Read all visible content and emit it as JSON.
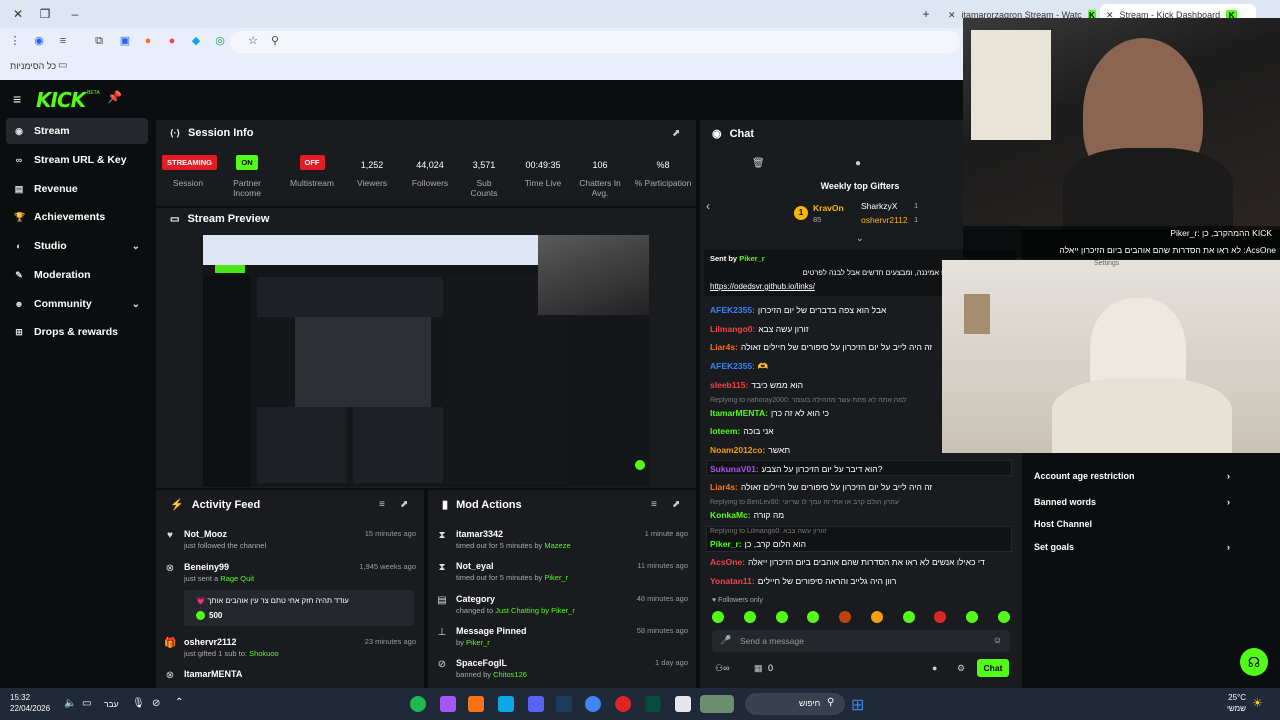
{
  "browser": {
    "tabs": [
      {
        "title": "itamarorzagron Stream - Watc"
      },
      {
        "title": "Stream - Kick Dashboard"
      }
    ],
    "bookmarks_label": "כל הסימניות"
  },
  "header": {
    "logo": "KICK",
    "logo_badge": "BETA"
  },
  "sidebar": {
    "items": [
      {
        "label": "Stream"
      },
      {
        "label": "Stream URL & Key"
      },
      {
        "label": "Revenue"
      },
      {
        "label": "Achievements"
      },
      {
        "label": "Studio"
      },
      {
        "label": "Moderation"
      },
      {
        "label": "Community"
      },
      {
        "label": "Drops & rewards"
      }
    ]
  },
  "session": {
    "title": "Session Info",
    "stats": [
      {
        "value": "STREAMING",
        "label": "Session"
      },
      {
        "value": "ON",
        "label": "Partner Income"
      },
      {
        "value": "OFF",
        "label": "Multistream"
      },
      {
        "value": "1,252",
        "label": "Viewers"
      },
      {
        "value": "44,024",
        "label": "Followers"
      },
      {
        "value": "3,571",
        "label": "Sub Counts"
      },
      {
        "value": "00:49:35",
        "label": "Time Live"
      },
      {
        "value": "106",
        "label": "Chatters In Avg."
      },
      {
        "value": "%8",
        "label": "% Participation"
      }
    ]
  },
  "preview": {
    "title": "Stream Preview"
  },
  "activity": {
    "title": "Activity Feed",
    "rows": [
      {
        "name": "Not_Mooz",
        "sub": "just followed the channel",
        "time": "15 minutes ago"
      },
      {
        "name": "Beneiny99",
        "sub": "just sent a",
        "sub_hl": "Rage Quit",
        "time": "1,945 weeks ago",
        "message": "עודד תהיה חזק אחי טתם צר עין אוהבים אותך 💗",
        "amount": "500"
      },
      {
        "name": "oshervr2112",
        "sub": "just gifted 1 sub to:",
        "sub_hl": "Shokuoo",
        "time": "23 minutes ago"
      },
      {
        "name": "ItamarMENTA",
        "sub": "",
        "time": ""
      }
    ]
  },
  "mod": {
    "title": "Mod Actions",
    "rows": [
      {
        "name": "itamar3342",
        "sub": "timed out for 5 minutes by",
        "by": "Mazeze",
        "time": "1 minute ago"
      },
      {
        "name": "Not_eyal",
        "sub": "timed out for 5 minutes by",
        "by": "Piker_r",
        "time": "11 minutes ago"
      },
      {
        "name": "Category",
        "sub": "changed to",
        "by": "Just Chatting by Piker_r",
        "time": "48 minutes ago"
      },
      {
        "name": "Message Pinned",
        "sub": "by",
        "by": "Piker_r",
        "time": "58 minutes ago"
      },
      {
        "name": "SpaceFogIL",
        "sub": "banned by",
        "by": "Chitos126",
        "time": "1 day ago"
      }
    ]
  },
  "chat": {
    "title": "Chat",
    "gifters_title": "Weekly top Gifters",
    "gifters": [
      {
        "name": "KravOn",
        "count": "85"
      },
      {
        "name": "SharkzyX",
        "count": "1"
      },
      {
        "name": "oshervr2112",
        "count": "1"
      }
    ],
    "pinned": {
      "sent_by": "Sent by",
      "user": "Piker_r",
      "text": "שיתוף פעולה חדש עם אמיננה, ומבצעים חדשים אבל לבנה לפרטים",
      "link": "https://odedsvr.github.io/links/"
    },
    "messages": [
      {
        "user": "AFEK2355:",
        "text": "אבל הוא צפה בדברים של יום הזיכרון",
        "color": "#3b82f6"
      },
      {
        "user": "Lilmango0:",
        "text": "זורון עשה צבא",
        "color": "#ef4444"
      },
      {
        "user": "Liar4s:",
        "text": "זה היה לייב על יום הזיכרון על סיפורים של חיילים זאולה",
        "color": "#f97316"
      },
      {
        "user": "AFEK2355:",
        "text": "🫶",
        "color": "#3b82f6"
      },
      {
        "user": "sleeb115:",
        "text": "הוא ממש כיבד",
        "color": "#ef4444"
      },
      {
        "user": "ItamarMENTA:",
        "text": "כי הוא לא זה כרן",
        "color": "#53fc18",
        "reply": "Replying to nahoray2000: למה אתה לא פתח עשר מההילה בעומר"
      },
      {
        "user": "loteem:",
        "text": "אני בוכה",
        "color": "#53fc18"
      },
      {
        "user": "Noam2012co:",
        "text": "תאשר",
        "color": "#f59e0b"
      },
      {
        "user": "SukunaV01:",
        "text": "הוא דיבר על יום הזיכרון על הצבע?",
        "color": "#a855f7",
        "highlight": true
      },
      {
        "user": "Liar4s:",
        "text": "זה היה לייב על יום הזיכרון על סיפורים של חיילים זאולה",
        "color": "#f97316"
      },
      {
        "user": "KonkaMc:",
        "text": "מה קורה",
        "color": "#53fc18",
        "reply": "Replying to BenLev90: עוזרון הולם קרב או אתי זה עמך לו שריוני"
      },
      {
        "user": "Piker_r:",
        "text": "הוא הלום קרב, כן",
        "color": "#53fc18",
        "reply": "Replying to Lilmango0: זוורון עשה צבא",
        "highlight": true
      },
      {
        "user": "AcsOne:",
        "text": "די כאילו אנשים לא ראו את הסדרות שהם אוהבים ביום הזיכרון ייאלה",
        "color": "#ef4444"
      },
      {
        "user": "Yonatan11:",
        "text": "רוון היה גלייב והראה סיפורים של חיילים",
        "color": "#ef4444"
      }
    ],
    "followers_only": "Followers only",
    "input_placeholder": "Send a message",
    "points": "0",
    "chat_button": "Chat"
  },
  "overlay": {
    "top_bar": "Piker_r: ההמהקרב, כן  KICK",
    "bottom_bar": "AcsOne: לא ראו את הסדרות שהם אוהבים ביום הזיכרון ייאלה",
    "settings": "Settings"
  },
  "right_panel": {
    "items": [
      {
        "label": "Account age restriction",
        "chevron": true
      },
      {
        "label": "Banned words",
        "chevron": true
      },
      {
        "label": "Host Channel",
        "chevron": false
      },
      {
        "label": "Set goals",
        "chevron": true
      }
    ]
  },
  "taskbar": {
    "time": "15:32",
    "date": "22/04/2026",
    "lang": "עבר",
    "search": "חיפוש",
    "weather_temp": "25°C",
    "weather_desc": "שמשי"
  },
  "colors": {
    "accent": "#53fc18",
    "panel": "#191b1f",
    "bg": "#0b0e0f",
    "live": "#e11d25"
  }
}
